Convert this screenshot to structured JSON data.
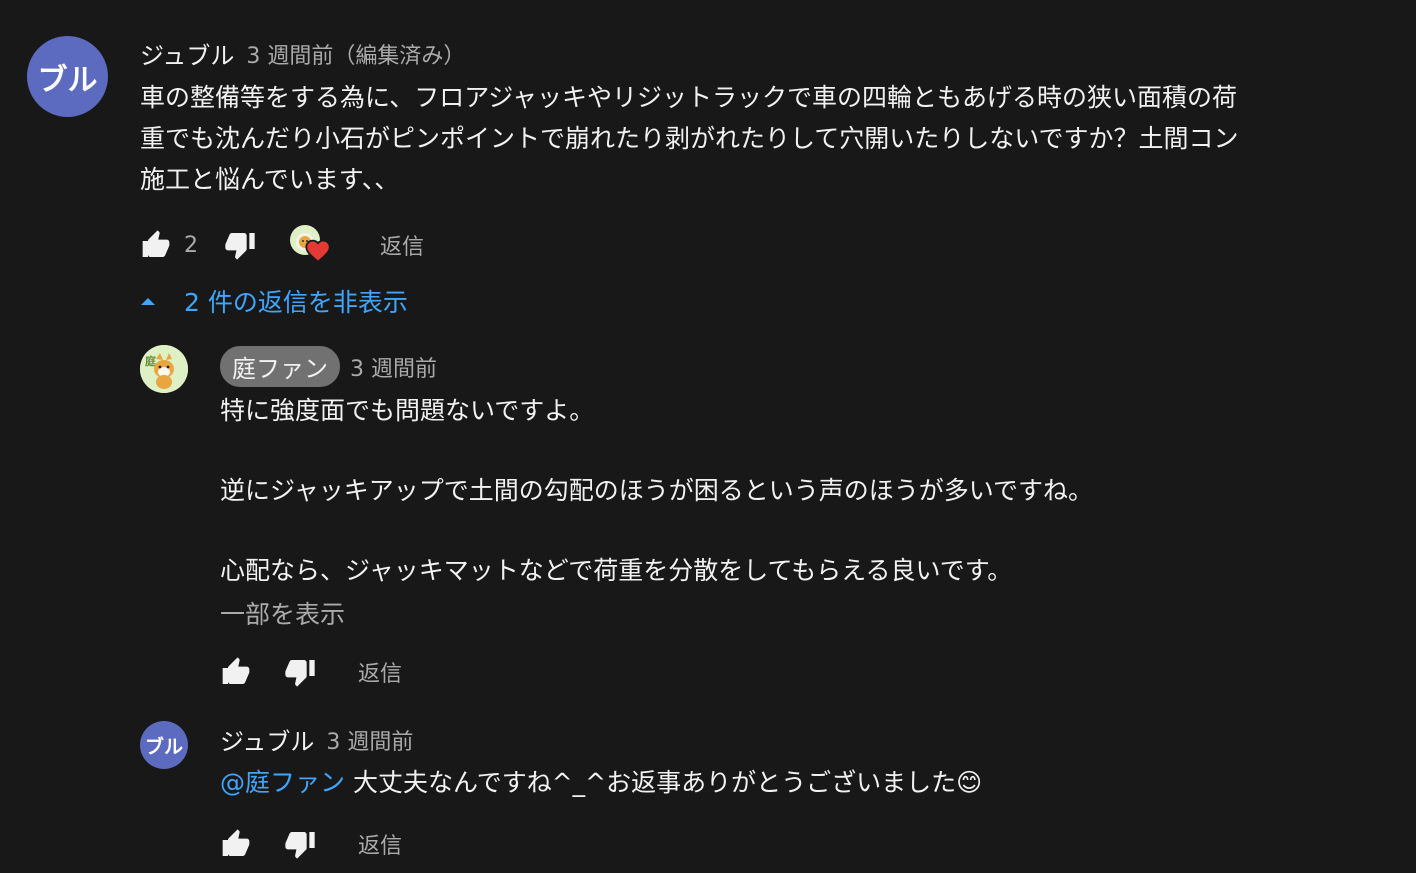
{
  "top_comment": {
    "avatar_text": "ブル",
    "author": "ジュブル",
    "time": "3 週間前（編集済み）",
    "lines": [
      "車の整備等をする為に、フロアジャッキやリジットラックで車の四輪ともあげる時の狭い面積の荷",
      "重でも沈んだり小石がピンポイントで崩れたり剥がれたりして穴開いたりしないですか？土間コン",
      "施工と悩んでいます、、"
    ],
    "like_count": "2",
    "reply_label": "返信",
    "hide_replies_label": "2 件の返信を非表示"
  },
  "reply1": {
    "author": "庭ファン",
    "time": "3 週間前",
    "lines": [
      "特に強度面でも問題ないですよ。",
      "",
      "逆にジャッキアップで土間の勾配のほうが困るという声のほうが多いですね。",
      "",
      "心配なら、ジャッキマットなどで荷重を分散をしてもらえる良いです。"
    ],
    "show_less_label": "一部を表示",
    "reply_label": "返信"
  },
  "reply2": {
    "avatar_text": "ブル",
    "author": "ジュブル",
    "time": "3 週間前",
    "mention": "@庭ファン",
    "text": " 大丈夫なんですね^_^お返事ありがとうございました😊",
    "reply_label": "返信"
  },
  "colors": {
    "background": "#181818",
    "link_blue": "#3ea6ff",
    "avatar_purple": "#5c6bc0",
    "heart_red": "#e53935"
  },
  "icons": [
    "thumbs-up-icon",
    "thumbs-down-icon",
    "heart-icon",
    "caret-up-icon",
    "shiba-avatar-icon"
  ]
}
